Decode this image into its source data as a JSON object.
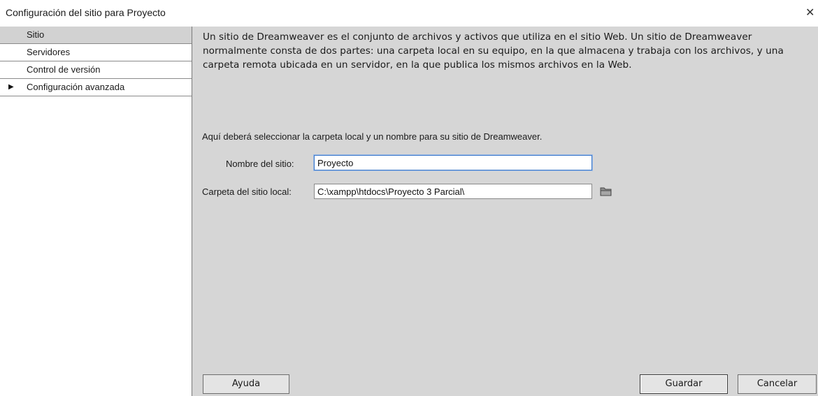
{
  "window": {
    "title": "Configuración del sitio para Proyecto",
    "close_glyph": "✕"
  },
  "sidebar": {
    "items": [
      {
        "label": "Sitio",
        "selected": true
      },
      {
        "label": "Servidores",
        "selected": false
      },
      {
        "label": "Control de versión",
        "selected": false
      },
      {
        "label": "Configuración avanzada",
        "selected": false,
        "expandable": true
      }
    ],
    "expand_glyph": "▶"
  },
  "main": {
    "intro": "Un sitio de Dreamweaver es el conjunto de archivos y activos que utiliza en el sitio Web. Un sitio de Dreamweaver normalmente consta de dos partes: una carpeta local en su equipo, en la que almacena y trabaja con los archivos, y una carpeta remota ubicada en un servidor, en la que publica los mismos archivos en la Web.",
    "hint": "Aquí deberá seleccionar la carpeta local y un nombre para su sitio de Dreamweaver.",
    "site_name": {
      "label": "Nombre del sitio:",
      "value": "Proyecto"
    },
    "local_folder": {
      "label": "Carpeta del sitio local:",
      "value": "C:\\xampp\\htdocs\\Proyecto 3 Parcial\\"
    }
  },
  "buttons": {
    "help": "Ayuda",
    "save": "Guardar",
    "cancel": "Cancelar"
  },
  "icons": {
    "close": "close-icon",
    "folder": "folder-icon",
    "expand": "triangle-right-icon"
  },
  "colors": {
    "content_bg": "#d6d6d6",
    "selected_item_bg": "#d2d2d2",
    "focus_border": "#3c78c8"
  }
}
